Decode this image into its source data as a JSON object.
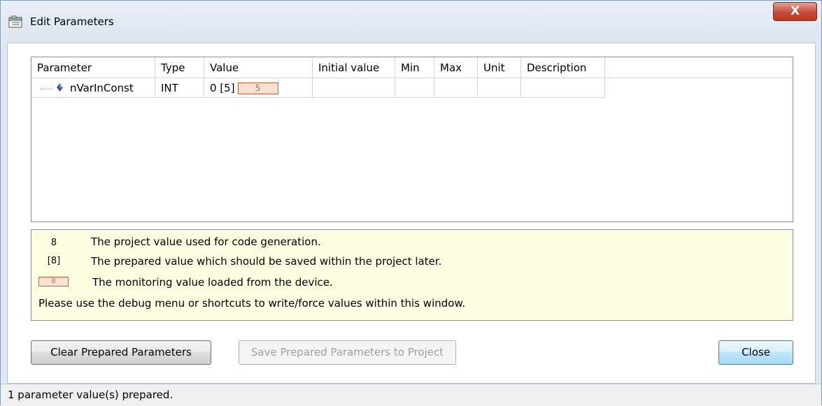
{
  "window": {
    "title": "Edit Parameters",
    "close_glyph": "X"
  },
  "table": {
    "columns": [
      "Parameter",
      "Type",
      "Value",
      "Initial value",
      "Min",
      "Max",
      "Unit",
      "Description"
    ],
    "rows": [
      {
        "parameter": "nVarInConst",
        "type": "INT",
        "value": "0 [5]",
        "monitor_value": "5",
        "initial_value": "",
        "min": "",
        "max": "",
        "unit": "",
        "description": ""
      }
    ]
  },
  "legend": {
    "project_value_symbol": "8",
    "project_value_text": "The project value used for code generation.",
    "prepared_value_symbol": "[8]",
    "prepared_value_text": "The prepared value which should be saved within the project later.",
    "monitoring_value_symbol": "8",
    "monitoring_value_text": "The monitoring value loaded from the device.",
    "hint": "Please use the debug menu or shortcuts to write/force values within this window."
  },
  "buttons": {
    "clear": "Clear Prepared Parameters",
    "save": "Save Prepared Parameters to Project",
    "close": "Close"
  },
  "status": "1 parameter value(s) prepared.",
  "colors": {
    "legend_bg": "#fdfde1",
    "monitor_bg": "#fbe1d2",
    "monitor_border": "#b8643f",
    "close_accent": "#c44a35"
  }
}
